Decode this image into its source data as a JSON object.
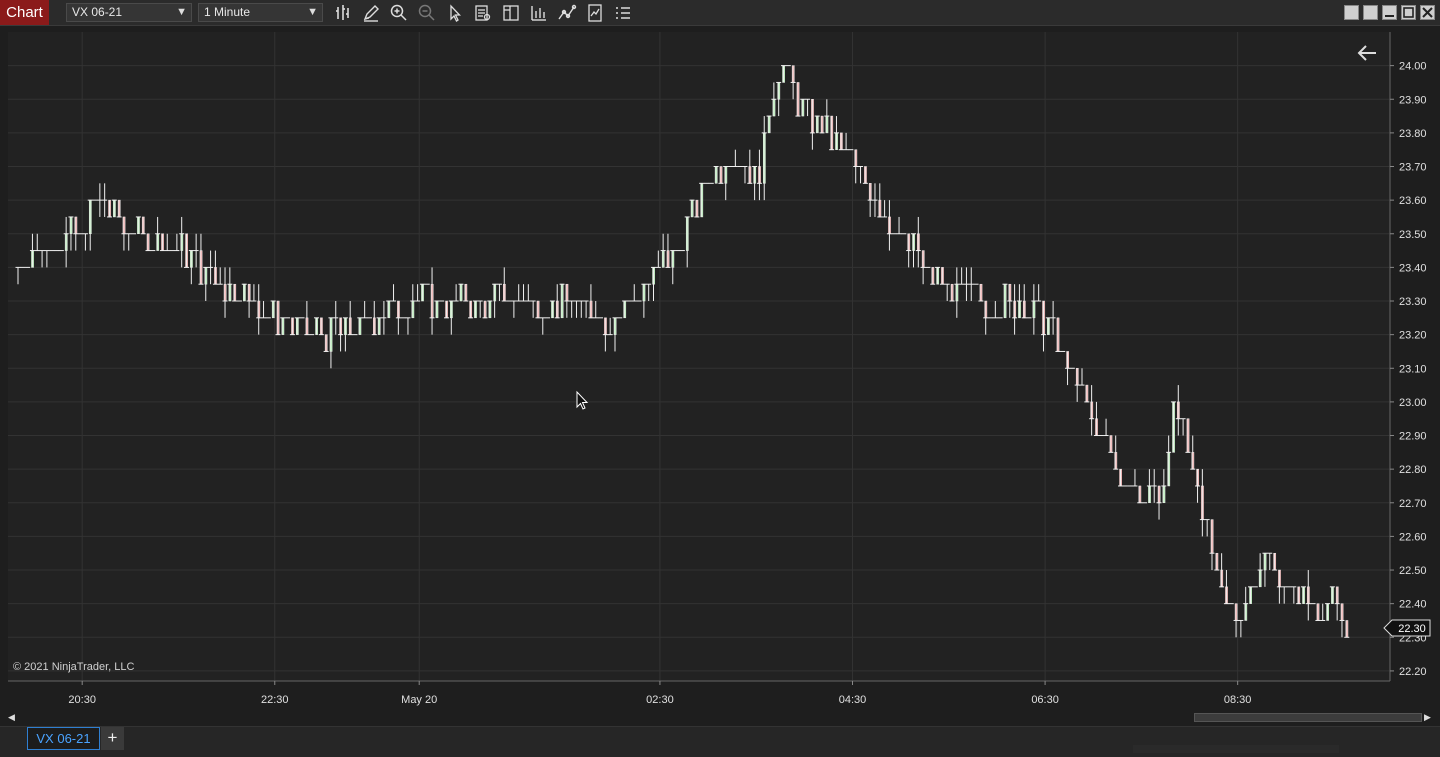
{
  "window": {
    "title": "Chart",
    "instrument": "VX 06-21",
    "interval": "1 Minute",
    "colors": {
      "title_bg": "#8b1a1a",
      "up_bar": "#90ee90",
      "down_bar": "#f08080",
      "background": "#222222",
      "grid": "#333333"
    }
  },
  "toolbar": {
    "icons": [
      "bar-style-icon",
      "draw-pencil-icon",
      "zoom-in-icon",
      "zoom-out-icon",
      "pointer-icon",
      "data-box-icon",
      "chart-trader-icon",
      "indicators-icon",
      "strategies-icon",
      "templates-icon",
      "properties-list-icon"
    ]
  },
  "window_controls": [
    "tile-icon",
    "tile-icon",
    "minimize-icon",
    "maximize-icon",
    "close-icon"
  ],
  "chart": {
    "copyright": "© 2021 NinjaTrader, LLC",
    "current_price": "22.30"
  },
  "chart_data": {
    "type": "bar",
    "bar_style": "open-high-low-close (OHLC)",
    "instrument": "VX 06-21",
    "interval": "1 Minute",
    "y_ticks": [
      "24.00",
      "23.90",
      "23.80",
      "23.70",
      "23.60",
      "23.50",
      "23.40",
      "23.30",
      "23.20",
      "23.10",
      "23.00",
      "22.90",
      "22.80",
      "22.70",
      "22.60",
      "22.50",
      "22.40",
      "22.30",
      "22.20"
    ],
    "x_ticks": [
      "20:30",
      "22:30",
      "May 20",
      "02:30",
      "04:30",
      "06:30",
      "08:30"
    ],
    "ylim": [
      22.17,
      24.1
    ],
    "grid": true,
    "current_price": 22.3,
    "price_path": [
      {
        "t": "19:50",
        "p": 23.4
      },
      {
        "t": "20:00",
        "p": 23.45
      },
      {
        "t": "20:30",
        "p": 23.5
      },
      {
        "t": "20:40",
        "p": 23.6
      },
      {
        "t": "21:00",
        "p": 23.5
      },
      {
        "t": "21:30",
        "p": 23.45
      },
      {
        "t": "22:00",
        "p": 23.35
      },
      {
        "t": "22:30",
        "p": 23.25
      },
      {
        "t": "23:00",
        "p": 23.2
      },
      {
        "t": "23:30",
        "p": 23.25
      },
      {
        "t": "00:00",
        "p": 23.3
      },
      {
        "t": "00:30",
        "p": 23.3
      },
      {
        "t": "01:00",
        "p": 23.3
      },
      {
        "t": "01:30",
        "p": 23.3
      },
      {
        "t": "02:00",
        "p": 23.25
      },
      {
        "t": "02:30",
        "p": 23.4
      },
      {
        "t": "02:45",
        "p": 23.5
      },
      {
        "t": "03:00",
        "p": 23.65
      },
      {
        "t": "03:15",
        "p": 23.75
      },
      {
        "t": "03:30",
        "p": 23.65
      },
      {
        "t": "03:40",
        "p": 23.9
      },
      {
        "t": "03:45",
        "p": 24.0
      },
      {
        "t": "04:00",
        "p": 23.85
      },
      {
        "t": "04:15",
        "p": 23.8
      },
      {
        "t": "04:30",
        "p": 23.7
      },
      {
        "t": "04:45",
        "p": 23.6
      },
      {
        "t": "05:00",
        "p": 23.5
      },
      {
        "t": "05:15",
        "p": 23.4
      },
      {
        "t": "05:30",
        "p": 23.35
      },
      {
        "t": "05:45",
        "p": 23.3
      },
      {
        "t": "06:00",
        "p": 23.3
      },
      {
        "t": "06:15",
        "p": 23.3
      },
      {
        "t": "06:30",
        "p": 23.25
      },
      {
        "t": "06:45",
        "p": 23.1
      },
      {
        "t": "07:00",
        "p": 22.95
      },
      {
        "t": "07:15",
        "p": 22.8
      },
      {
        "t": "07:30",
        "p": 22.7
      },
      {
        "t": "07:45",
        "p": 22.75
      },
      {
        "t": "07:50",
        "p": 23.0
      },
      {
        "t": "08:00",
        "p": 22.85
      },
      {
        "t": "08:10",
        "p": 22.65
      },
      {
        "t": "08:20",
        "p": 22.4
      },
      {
        "t": "08:30",
        "p": 22.35
      },
      {
        "t": "08:45",
        "p": 22.55
      },
      {
        "t": "09:00",
        "p": 22.45
      },
      {
        "t": "09:15",
        "p": 22.4
      },
      {
        "t": "09:30",
        "p": 22.4
      },
      {
        "t": "09:40",
        "p": 22.3
      }
    ]
  },
  "scrollbar": {
    "thumb_position": 0.84
  },
  "bottom_tabs": {
    "instrument_tab": "VX 06-21",
    "add_label": "+"
  }
}
